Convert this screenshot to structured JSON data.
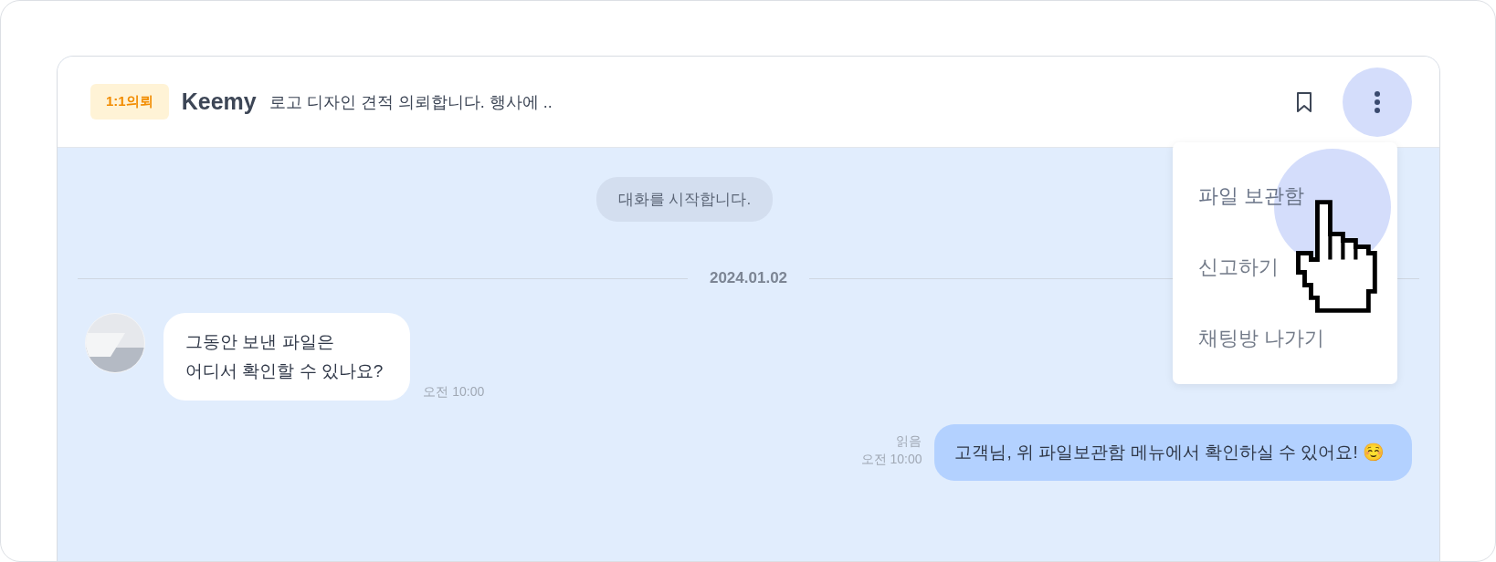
{
  "chat": {
    "badge": "1:1의뢰",
    "name": "Keemy",
    "subject": "로고 디자인 견적 의뢰합니다. 행사에 .."
  },
  "menu": {
    "open": true,
    "items": [
      {
        "label": "파일 보관함",
        "selected": true
      },
      {
        "label": "신고하기",
        "selected": false
      },
      {
        "label": "채팅방 나가기",
        "selected": false
      }
    ]
  },
  "system_notice": "대화를 시작합니다.",
  "date": "2024.01.02",
  "messages": [
    {
      "kind": "received",
      "lines": [
        "그동안 보낸 파일은",
        "어디서 확인할 수 있나요?"
      ],
      "time": "오전 10:00"
    },
    {
      "kind": "sent",
      "lines": [
        "고객님, 위 파일보관함 메뉴에서 확인하실 수 있어요! ☺️"
      ],
      "status": "읽음",
      "time": "오전 10:00"
    }
  ]
}
